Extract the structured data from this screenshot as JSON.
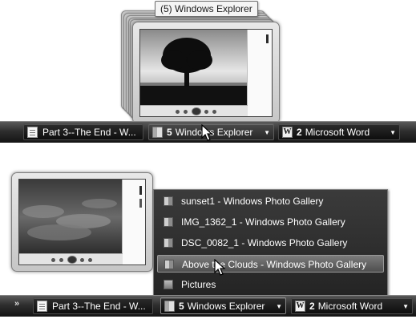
{
  "top_scene": {
    "preview_caption": "(5) Windows Explorer",
    "taskbar": {
      "items": [
        {
          "label": "Part 3--The End - W...",
          "count": "",
          "icon": "document-icon"
        },
        {
          "label": "Windows Explorer",
          "count": "5",
          "icon": "folder-icon",
          "has_arrow": true
        },
        {
          "label": "Microsoft Word",
          "count": "2",
          "icon": "word-icon",
          "has_arrow": true
        }
      ]
    }
  },
  "bottom_scene": {
    "jump_list": {
      "items": [
        {
          "label": "sunset1 - Windows Photo Gallery",
          "highlighted": false
        },
        {
          "label": "IMG_1362_1 - Windows Photo Gallery",
          "highlighted": false
        },
        {
          "label": "DSC_0082_1 - Windows Photo Gallery",
          "highlighted": false
        },
        {
          "label": "Above the Clouds - Windows Photo Gallery",
          "highlighted": true
        },
        {
          "label": "Pictures",
          "highlighted": false
        }
      ]
    },
    "taskbar": {
      "overflow_chevron": "»",
      "items": [
        {
          "label": "Part 3--The End - W...",
          "count": "",
          "icon": "document-icon"
        },
        {
          "label": "Windows Explorer",
          "count": "5",
          "icon": "folder-icon",
          "has_arrow": true
        },
        {
          "label": "Microsoft Word",
          "count": "2",
          "icon": "word-icon",
          "has_arrow": true
        }
      ]
    }
  },
  "colors": {
    "taskbar_dark": "#141414",
    "menu_bg": "#2f2f2f",
    "highlight": "#6a6a6a"
  }
}
